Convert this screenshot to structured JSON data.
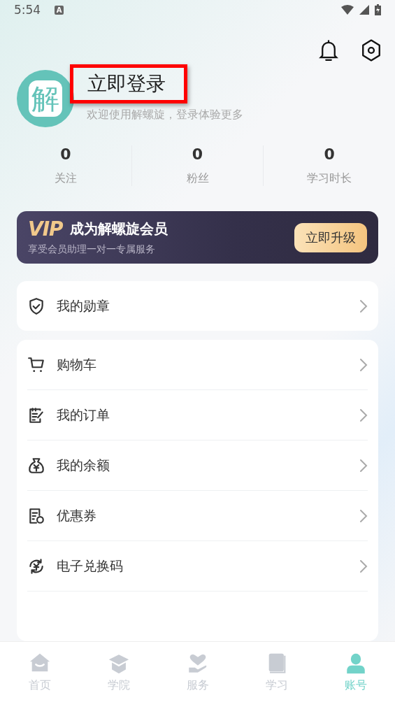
{
  "status_bar": {
    "time": "5:54",
    "notification": "A"
  },
  "profile": {
    "avatar_text": "解",
    "title": "立即登录",
    "highlighted": true,
    "subtitle": "欢迎使用解螺旋，登录体验更多"
  },
  "stats": [
    {
      "value": "0",
      "label": "关注"
    },
    {
      "value": "0",
      "label": "粉丝"
    },
    {
      "value": "0",
      "label": "学习时长"
    }
  ],
  "vip_banner": {
    "badge": "VIP",
    "title": "成为解螺旋会员",
    "subtitle": "享受会员助理一对一专属服务",
    "button": "立即升级"
  },
  "badge_card": {
    "kind": "badge",
    "label": "我的勋章"
  },
  "menu": [
    {
      "kind": "cart",
      "label": "购物车"
    },
    {
      "kind": "order",
      "label": "我的订单"
    },
    {
      "kind": "balance",
      "label": "我的余额"
    },
    {
      "kind": "coupon",
      "label": "优惠券"
    },
    {
      "kind": "redeem",
      "label": "电子兑换码"
    }
  ],
  "bottom_nav": [
    {
      "kind": "home",
      "label": "首页",
      "selected": false
    },
    {
      "kind": "academy",
      "label": "学院",
      "selected": false
    },
    {
      "kind": "service",
      "label": "服务",
      "selected": false
    },
    {
      "kind": "study",
      "label": "学习",
      "selected": false
    },
    {
      "kind": "account",
      "label": "账号",
      "selected": true
    }
  ]
}
